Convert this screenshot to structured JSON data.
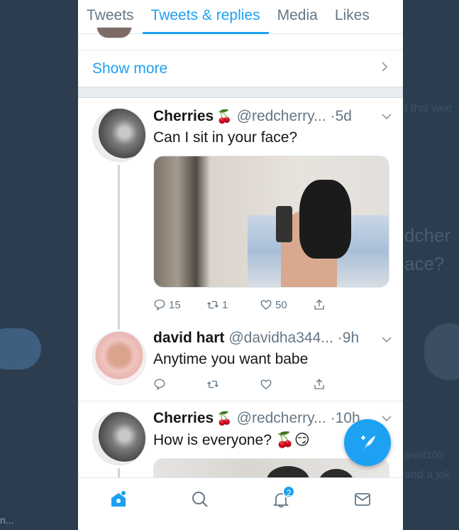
{
  "tabs": [
    {
      "label": "Tweets"
    },
    {
      "label": "Tweets & replies"
    },
    {
      "label": "Media"
    },
    {
      "label": "Likes"
    }
  ],
  "active_tab": "Tweets & replies",
  "show_more": {
    "label": "Show more",
    "icon": "chevron-right-icon"
  },
  "tweets": [
    {
      "name": "Cherries",
      "emoji": "🍒",
      "handle": "@redcherry...",
      "time": "·5d",
      "text": "Can I sit in your face?",
      "has_media": true,
      "replies": "15",
      "retweets": "1",
      "likes": "50"
    },
    {
      "name": "david hart",
      "emoji": "",
      "handle": "@davidha344...",
      "time": "·9h",
      "text": "Anytime you want babe",
      "has_media": false,
      "replies": "",
      "retweets": "",
      "likes": ""
    },
    {
      "name": "Cherries",
      "emoji": "🍒",
      "handle": "@redcherry...",
      "time": "·10h",
      "text": "How is everyone? 🍒😏",
      "has_media": true
    }
  ],
  "compose_button": {
    "icon": "compose-tweet-icon"
  },
  "bottom_nav": [
    {
      "icon": "home-icon",
      "active": true
    },
    {
      "icon": "search-icon"
    },
    {
      "icon": "notifications-icon",
      "badge": "2"
    },
    {
      "icon": "messages-icon"
    }
  ],
  "background_fragments": {
    "right_top": "t this wee",
    "right_mid1": "dcher",
    "right_mid2": "ace?",
    "right_small1": "areid100",
    "right_small2": "and a jok",
    "left_bottom": "n..."
  },
  "colors": {
    "accent": "#1da1f2",
    "text_primary": "#14171a",
    "text_secondary": "#657786",
    "background": "#2b3d4f"
  }
}
